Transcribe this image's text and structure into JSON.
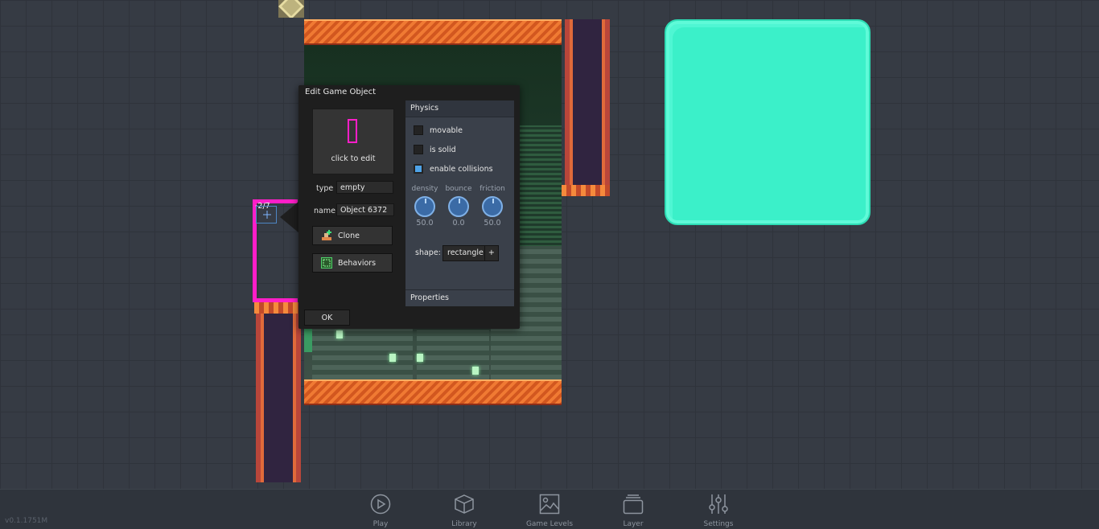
{
  "dialog": {
    "title": "Edit Game Object",
    "thumbnail_label": "click to edit",
    "type_label": "type",
    "type_value": "empty",
    "name_label": "name",
    "name_value": "Object 6372",
    "clone_label": "Clone",
    "behaviors_label": "Behaviors",
    "ok_label": "OK",
    "physics": {
      "header": "Physics",
      "movable_label": "movable",
      "movable_checked": false,
      "solid_label": "is solid",
      "solid_checked": false,
      "collisions_label": "enable collisions",
      "collisions_checked": true,
      "density_label": "density",
      "density_value": "50.0",
      "bounce_label": "bounce",
      "bounce_value": "0.0",
      "friction_label": "friction",
      "friction_value": "50.0",
      "shape_label": "shape:",
      "shape_value": "rectangle",
      "shape_add": "+"
    },
    "properties_header": "Properties"
  },
  "canvas": {
    "object_counter": "-2/7"
  },
  "bottom_nav": [
    {
      "label": "Play",
      "icon": "play-icon"
    },
    {
      "label": "Library",
      "icon": "cube-icon"
    },
    {
      "label": "Game Levels",
      "icon": "image-icon"
    },
    {
      "label": "Layer",
      "icon": "layers-icon"
    },
    {
      "label": "Settings",
      "icon": "sliders-icon"
    }
  ],
  "version": "v0.1.1751M",
  "colors": {
    "accent_magenta": "#ff1ec8",
    "checkbox_on": "#4ea3e8",
    "teal_block": "#3bf0c9"
  }
}
